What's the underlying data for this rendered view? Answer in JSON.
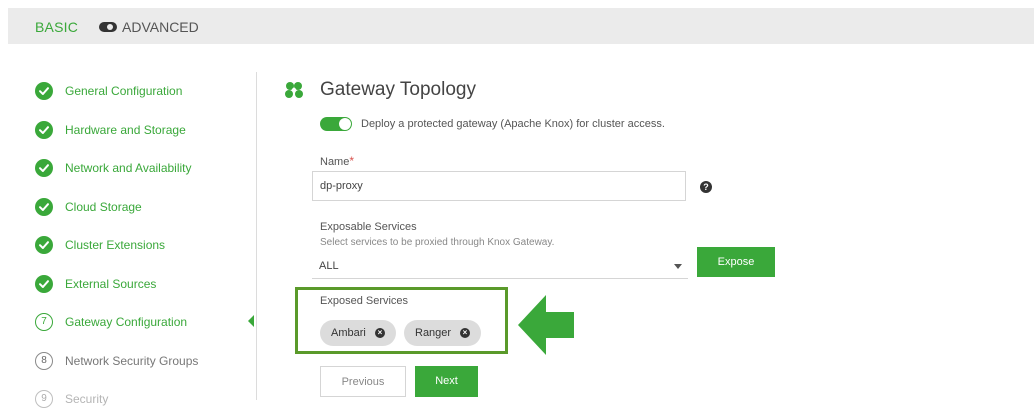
{
  "mode": {
    "basic": "BASIC",
    "advanced": "ADVANCED"
  },
  "steps": [
    {
      "label": "General Configuration",
      "state": "done"
    },
    {
      "label": "Hardware and Storage",
      "state": "done"
    },
    {
      "label": "Network and Availability",
      "state": "done"
    },
    {
      "label": "Cloud Storage",
      "state": "done"
    },
    {
      "label": "Cluster Extensions",
      "state": "done"
    },
    {
      "label": "External Sources",
      "state": "done"
    },
    {
      "label": "Gateway Configuration",
      "state": "active",
      "number": "7"
    },
    {
      "label": "Network Security Groups",
      "state": "pending",
      "number": "8"
    },
    {
      "label": "Security",
      "state": "pending",
      "number": "9"
    }
  ],
  "gateway": {
    "title": "Gateway Topology",
    "deploy_text": "Deploy a protected gateway (Apache Knox) for cluster access.",
    "name_label": "Name",
    "name_required": "*",
    "name_value": "dp-proxy",
    "help_icon": "?",
    "exposable_label": "Exposable Services",
    "exposable_hint": "Select services to be proxied through Knox Gateway.",
    "exposable_value": "ALL",
    "expose_button": "Expose",
    "exposed_label": "Exposed Services",
    "chips": [
      "Ambari",
      "Ranger"
    ],
    "chip_remove": "×"
  },
  "nav": {
    "previous": "Previous",
    "next": "Next"
  },
  "colors": {
    "accent": "#3aa83a",
    "highlight_box": "#5a9a2a",
    "arrow": "#3aa83a"
  }
}
